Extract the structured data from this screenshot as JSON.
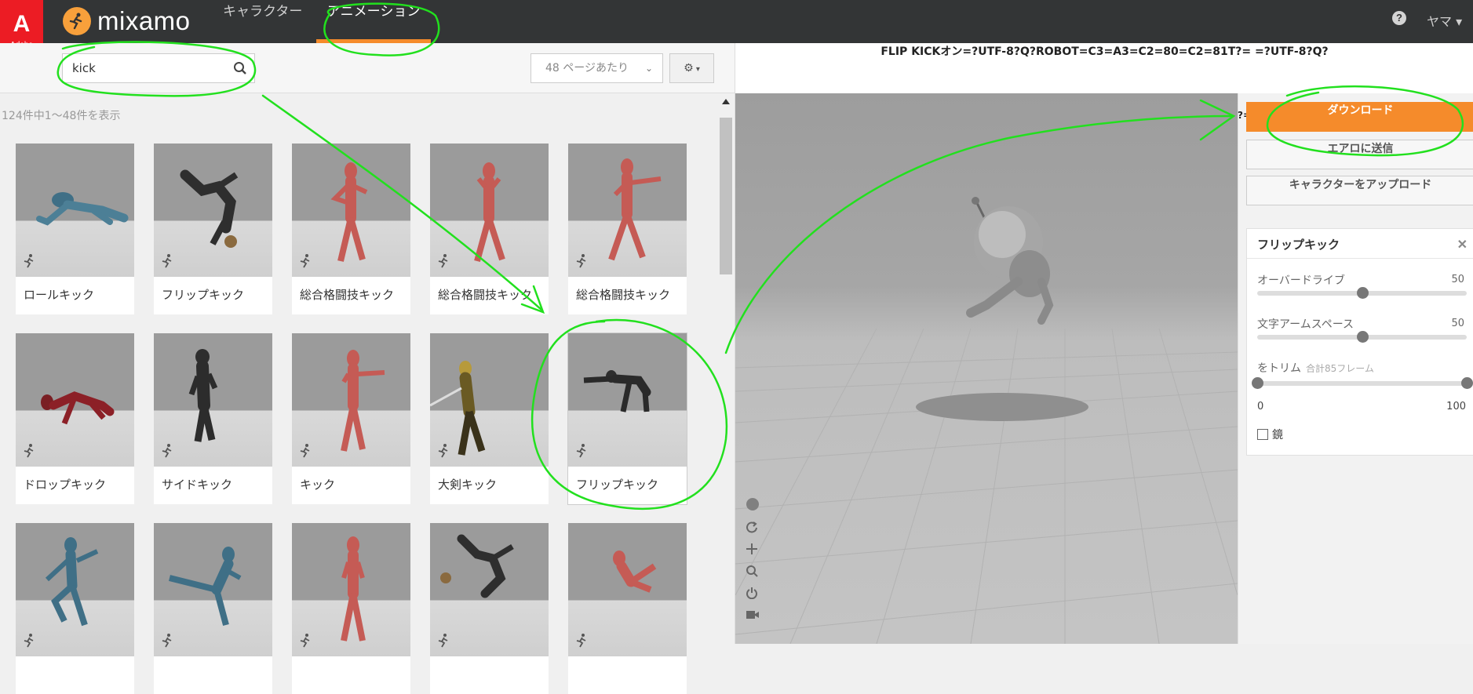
{
  "topbar": {
    "adobe_label": "Adobe",
    "brand": "mixamo",
    "tabs": [
      {
        "label": "キャラクター"
      },
      {
        "label": "アニメーション"
      }
    ],
    "help": "?",
    "user": "ヤマ"
  },
  "search": {
    "value": "kick",
    "per_page": "48 ページあたり"
  },
  "results": {
    "count_text": "124件中1～48件を表示",
    "cards": [
      {
        "label": "ロールキック"
      },
      {
        "label": "フリップキック"
      },
      {
        "label": "総合格闘技キック"
      },
      {
        "label": "総合格闘技キック"
      },
      {
        "label": "総合格闘技キック"
      },
      {
        "label": "ドロップキック"
      },
      {
        "label": "サイドキック"
      },
      {
        "label": "キック"
      },
      {
        "label": "大剣キック"
      },
      {
        "label": "フリップキック"
      },
      {
        "label": ""
      },
      {
        "label": ""
      },
      {
        "label": ""
      },
      {
        "label": ""
      },
      {
        "label": ""
      }
    ]
  },
  "viewer": {
    "title": "FLIP KICKオン=?UTF-8?Q?ROBOT=C3=A3=C2=80=C2=81T?= =?UTF-8?Q?",
    "cut_text": "?="
  },
  "actions": {
    "download": "ダウンロード",
    "send_to_aero": "エアロに送信",
    "upload_character": "キャラクターをアップロード"
  },
  "settings": {
    "title": "フリップキック",
    "params": [
      {
        "label": "オーバードライブ",
        "value": "50",
        "fraction": 0.5
      },
      {
        "label": "文字アームスペース",
        "value": "50",
        "fraction": 0.5
      }
    ],
    "trim_label": "をトリム",
    "trim_note": "合計85フレーム",
    "trim_min": "0",
    "trim_max": "100",
    "mirror_label": "鏡"
  },
  "colors": {
    "accent": "#f58b2b",
    "annotation": "#22e01e"
  }
}
